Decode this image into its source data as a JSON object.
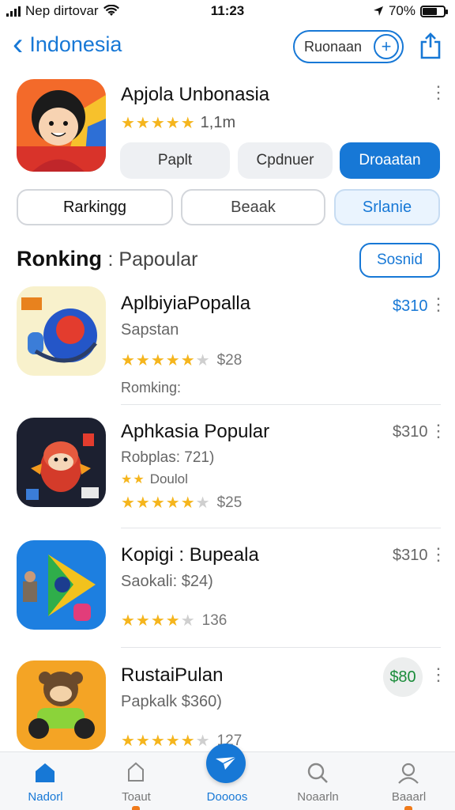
{
  "status_bar": {
    "carrier": "Nep dirtovar",
    "time": "11:23",
    "battery": "70%"
  },
  "nav": {
    "back_label": "Indonesia",
    "search_label": "Ruonaan"
  },
  "header_app": {
    "title": "Apjola Unbonasia",
    "rating_count": "1,1m",
    "stars": 5,
    "buttons": [
      "Paplt",
      "Cpdnuer",
      "Droaatan"
    ]
  },
  "segments": [
    "Rarkingg",
    "Beaak",
    "Srlanie"
  ],
  "section": {
    "title": "Ronking",
    "subtitle": ": Papoular",
    "button": "Sosnid"
  },
  "apps": [
    {
      "title": "AplbiyiaPopalla",
      "sub1": "Sapstan",
      "rating_text": "$28",
      "extra": "Romking:",
      "price": "$310",
      "stars": 5
    },
    {
      "title": "Aphkasia Popular",
      "sub1": "Robplas: 721)",
      "sub2": "Doulol",
      "rating_text": "$25",
      "price": "$310",
      "stars": 5
    },
    {
      "title": "Kopigi : Bupeala",
      "sub1": "Saokali: $24)",
      "rating_text": "136",
      "price": "$310",
      "stars": 4
    },
    {
      "title": "RustaiPulan",
      "sub1": "Papkalk $360)",
      "rating_text": "127",
      "price": "$80",
      "stars": 5
    }
  ],
  "tabs": [
    "Nadorl",
    "Toaut",
    "Doooos",
    "Noaarln",
    "Baaarl"
  ],
  "colors": {
    "accent": "#1778d6",
    "star": "#f5b51d",
    "price_green": "#1a8c3a"
  },
  "icons": {
    "signal": "signal-icon",
    "wifi": "wifi-icon",
    "location": "location-arrow-icon",
    "battery": "battery-icon",
    "back": "chevron-left-icon",
    "add": "plus-icon",
    "share": "share-icon",
    "more": "kebab-icon"
  }
}
